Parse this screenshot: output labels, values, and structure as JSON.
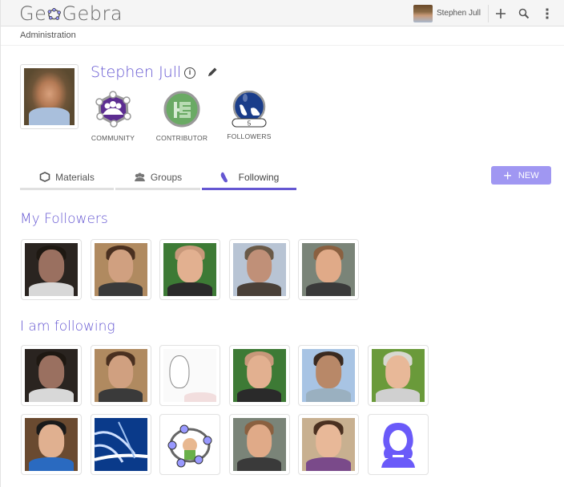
{
  "app": {
    "logo_text_prefix": "Ge",
    "logo_text_suffix": "Gebra",
    "logo_full": "GeoGebra"
  },
  "topbar": {
    "user_name": "Stephen Jull",
    "icons": [
      "plus-icon",
      "search-icon",
      "more-vertical-icon"
    ]
  },
  "breadcrumb": "Administration",
  "profile": {
    "name": "Stephen Jull",
    "badges": [
      {
        "label": "COMMUNITY",
        "icon": "community-badge-icon",
        "color": "#5c2d91"
      },
      {
        "label": "CONTRIBUTOR",
        "icon": "contributor-badge-icon",
        "color": "#6aaa64"
      },
      {
        "label": "FOLLOWERS",
        "icon": "followers-badge-icon",
        "color": "#1a3d8a",
        "count": "5"
      }
    ]
  },
  "tabs": [
    {
      "label": "Materials",
      "icon": "materials-icon",
      "active": false
    },
    {
      "label": "Groups",
      "icon": "groups-icon",
      "active": false
    },
    {
      "label": "Following",
      "icon": "following-icon",
      "active": true
    }
  ],
  "new_button": {
    "label": "NEW"
  },
  "colors": {
    "accent": "#6557d2",
    "button": "#a097f2",
    "tab_inactive": "#e0e0e0"
  },
  "followers": {
    "title": "My Followers",
    "users": [
      {
        "avatar": "user-avatar-1"
      },
      {
        "avatar": "user-avatar-2"
      },
      {
        "avatar": "user-avatar-3"
      },
      {
        "avatar": "user-avatar-4"
      },
      {
        "avatar": "user-avatar-5"
      }
    ]
  },
  "following": {
    "title": "I am following",
    "users": [
      {
        "avatar": "user-avatar-1"
      },
      {
        "avatar": "user-avatar-2"
      },
      {
        "avatar": "sketch-avatar"
      },
      {
        "avatar": "user-avatar-3"
      },
      {
        "avatar": "user-avatar-6"
      },
      {
        "avatar": "user-avatar-7"
      },
      {
        "avatar": "user-avatar-8"
      },
      {
        "avatar": "logo-avatar"
      },
      {
        "avatar": "geogebra-avatar"
      },
      {
        "avatar": "user-avatar-5"
      },
      {
        "avatar": "user-avatar-9"
      },
      {
        "avatar": "default-female-avatar"
      }
    ]
  }
}
